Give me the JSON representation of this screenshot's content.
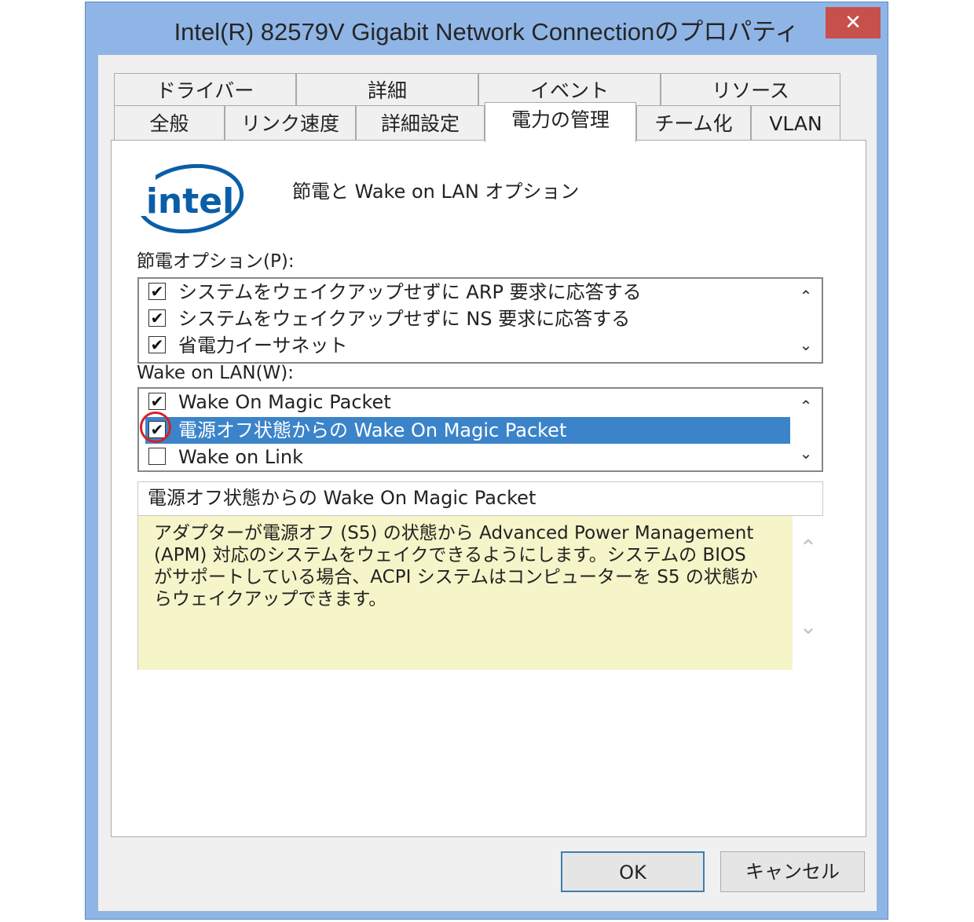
{
  "window": {
    "title": "Intel(R) 82579V Gigabit Network Connectionのプロパティ",
    "close_glyph": "✕"
  },
  "tabs": {
    "row1": [
      "ドライバー",
      "詳細",
      "イベント",
      "リソース"
    ],
    "row2": [
      "全般",
      "リンク速度",
      "詳細設定",
      "電力の管理",
      "チーム化",
      "VLAN"
    ],
    "active": "電力の管理"
  },
  "panel": {
    "logo_text": "intel",
    "header": "節電と Wake on LAN オプション",
    "power_saving": {
      "label": "節電オプション(P):",
      "items": [
        {
          "label": "システムをウェイクアップせずに ARP 要求に応答する",
          "checked": true
        },
        {
          "label": "システムをウェイクアップせずに NS 要求に応答する",
          "checked": true
        },
        {
          "label": "省電力イーサネット",
          "checked": true
        }
      ]
    },
    "wake_on_lan": {
      "label": "Wake on LAN(W):",
      "items": [
        {
          "label": "Wake On Magic Packet",
          "checked": true,
          "selected": false
        },
        {
          "label": "電源オフ状態からの Wake On Magic Packet",
          "checked": true,
          "selected": true
        },
        {
          "label": "Wake on Link",
          "checked": false,
          "selected": false
        }
      ]
    },
    "description": {
      "title": "電源オフ状態からの Wake On Magic Packet",
      "lines": [
        "アダプターが電源オフ (S5) の状態から Advanced Power Management",
        "(APM) 対応のシステムをウェイクできるようにします。システムの BIOS",
        "がサポートしている場合、ACPI システムはコンピューターを S5 の状態か",
        "らウェイクアップできます。"
      ]
    },
    "scroll_up_glyph": "⌃",
    "scroll_down_glyph": "⌄",
    "check_glyph": "✔"
  },
  "buttons": {
    "ok": "OK",
    "cancel": "キャンセル"
  },
  "colors": {
    "title_bar": "#8fb5e6",
    "close": "#c7504b",
    "selection": "#3b84c9",
    "intel_blue": "#0a5ea8",
    "description_bg": "#f6f5c9",
    "annotation": "#d82020"
  }
}
